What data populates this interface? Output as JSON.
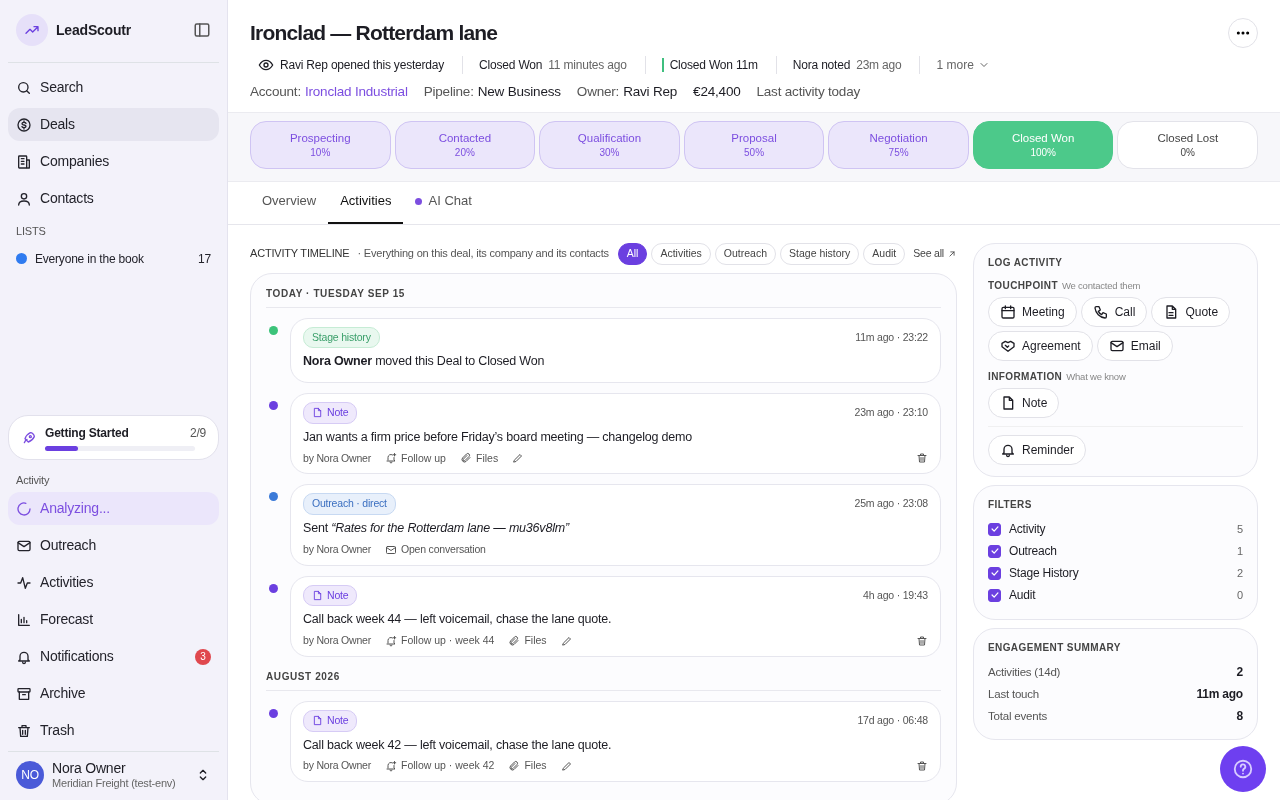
{
  "brand": {
    "name": "LeadScoutr"
  },
  "nav": [
    {
      "label": "Search",
      "selected": false
    },
    {
      "label": "Deals",
      "selected": true
    },
    {
      "label": "Companies",
      "selected": false
    },
    {
      "label": "Contacts",
      "selected": false
    }
  ],
  "lists": {
    "heading": "LISTS",
    "items": [
      {
        "label": "Everyone in the book",
        "count": "17",
        "color": "#2f7bf0"
      }
    ]
  },
  "getting_started": {
    "label": "Getting Started",
    "count": "2/9",
    "level": 0.22
  },
  "activity_nav": {
    "heading": "Activity",
    "items": [
      {
        "label": "Analyzing...",
        "selected": true
      },
      {
        "label": "Outreach",
        "selected": false
      },
      {
        "label": "Activities",
        "selected": false
      },
      {
        "label": "Forecast",
        "selected": false
      },
      {
        "label": "Notifications",
        "selected": false,
        "badge": "3"
      },
      {
        "label": "Archive",
        "selected": false
      },
      {
        "label": "Trash",
        "selected": false
      }
    ]
  },
  "user": {
    "initials": "NO",
    "name": "Nora Owner",
    "org": "Meridian Freight (test-env)"
  },
  "deal": {
    "title": "Ironclad — Rotterdam lane",
    "events": [
      {
        "kind": "view",
        "text": "Ravi Rep opened this yesterday"
      },
      {
        "kind": "plain",
        "text": "Closed Won",
        "time": "11 minutes ago"
      },
      {
        "kind": "stage",
        "text": "Closed Won 11m"
      },
      {
        "kind": "plain",
        "text": "Nora noted",
        "time": "23m ago"
      }
    ],
    "more": "1 more",
    "meta": [
      {
        "kind": "link",
        "label": "Account:",
        "value": "Ironclad Industrial"
      },
      {
        "kind": "text",
        "label": "Pipeline:",
        "value": "New Business"
      },
      {
        "kind": "text",
        "label": "Owner:",
        "value": "Ravi Rep"
      },
      {
        "kind": "amount",
        "value": "€24,400"
      },
      {
        "kind": "muted",
        "value": "Last activity today"
      }
    ]
  },
  "stages": [
    {
      "name": "Prospecting",
      "percent": "10%",
      "selected": false
    },
    {
      "name": "Contacted",
      "percent": "20%",
      "selected": false
    },
    {
      "name": "Qualification",
      "percent": "30%",
      "selected": false
    },
    {
      "name": "Proposal",
      "percent": "50%",
      "selected": false
    },
    {
      "name": "Negotiation",
      "percent": "75%",
      "selected": false
    },
    {
      "name": "Closed Won",
      "percent": "100%",
      "selected": true
    },
    {
      "name": "Closed Lost",
      "percent": "0%",
      "selected": false
    }
  ],
  "tabs": [
    {
      "label": "Overview",
      "selected": false,
      "dot": false
    },
    {
      "label": "Activities",
      "selected": true,
      "dot": false
    },
    {
      "label": "AI Chat",
      "selected": false,
      "dot": true
    }
  ],
  "timeline": {
    "title": "ACTIVITY TIMELINE",
    "subtitle": "· Everything on this deal, its company and its contacts",
    "filters": [
      {
        "label": "All",
        "selected": true
      },
      {
        "label": "Activities",
        "selected": false
      },
      {
        "label": "Outreach",
        "selected": false
      },
      {
        "label": "Stage history",
        "selected": false
      },
      {
        "label": "Audit",
        "selected": false
      }
    ],
    "see_all": "See all",
    "groups": [
      {
        "heading": "TODAY · TUESDAY SEP 15",
        "items": [
          {
            "kind": "stage",
            "tag": "Stage history",
            "time": "11m ago · 23:22",
            "text": "**Nora Owner** moved this Deal to Closed Won"
          },
          {
            "kind": "note",
            "tag": "Note",
            "time": "23m ago · 23:10",
            "text": "Jan wants a firm price before Friday’s board meeting — changelog demo",
            "by": "by Nora Owner",
            "follow": "Follow up",
            "files": "Files"
          },
          {
            "kind": "outreach",
            "tag": "Outreach · direct",
            "time": "25m ago · 23:08",
            "text": "Sent *“Rates for the Rotterdam lane — mu36v8lm”*",
            "by": "by Nora Owner",
            "link": "Open conversation"
          },
          {
            "kind": "note",
            "tag": "Note",
            "time": "4h ago · 19:43",
            "text": "Call back week 44 — left voicemail, chase the lane quote.",
            "by": "by Nora Owner",
            "follow": "Follow up · week 44",
            "files": "Files"
          }
        ]
      },
      {
        "heading": "AUGUST 2026",
        "items": [
          {
            "kind": "note",
            "tag": "Note",
            "time": "17d ago · 06:48",
            "text": "Call back week 42 — left voicemail, chase the lane quote.",
            "by": "by Nora Owner",
            "follow": "Follow up · week 42",
            "files": "Files"
          }
        ]
      }
    ]
  },
  "log_activity": {
    "title": "LOG ACTIVITY",
    "sections": [
      {
        "heading": "TOUCHPOINT",
        "hint": "We contacted them",
        "buttons": [
          {
            "label": "Meeting"
          },
          {
            "label": "Call"
          },
          {
            "label": "Quote"
          },
          {
            "label": "Agreement"
          },
          {
            "label": "Email"
          }
        ]
      },
      {
        "heading": "INFORMATION",
        "hint": "What we know",
        "buttons": [
          {
            "label": "Note"
          }
        ]
      }
    ],
    "reminder": {
      "label": "Reminder"
    }
  },
  "filters": {
    "title": "FILTERS",
    "items": [
      {
        "label": "Activity",
        "count": "5",
        "checked": true
      },
      {
        "label": "Outreach",
        "count": "1",
        "checked": true
      },
      {
        "label": "Stage History",
        "count": "2",
        "checked": true
      },
      {
        "label": "Audit",
        "count": "0",
        "checked": true
      }
    ]
  },
  "summary": {
    "title": "ENGAGEMENT SUMMARY",
    "rows": [
      {
        "label": "Activities (14d)",
        "value": "2"
      },
      {
        "label": "Last touch",
        "value": "11m ago"
      },
      {
        "label": "Total events",
        "value": "8"
      }
    ]
  }
}
